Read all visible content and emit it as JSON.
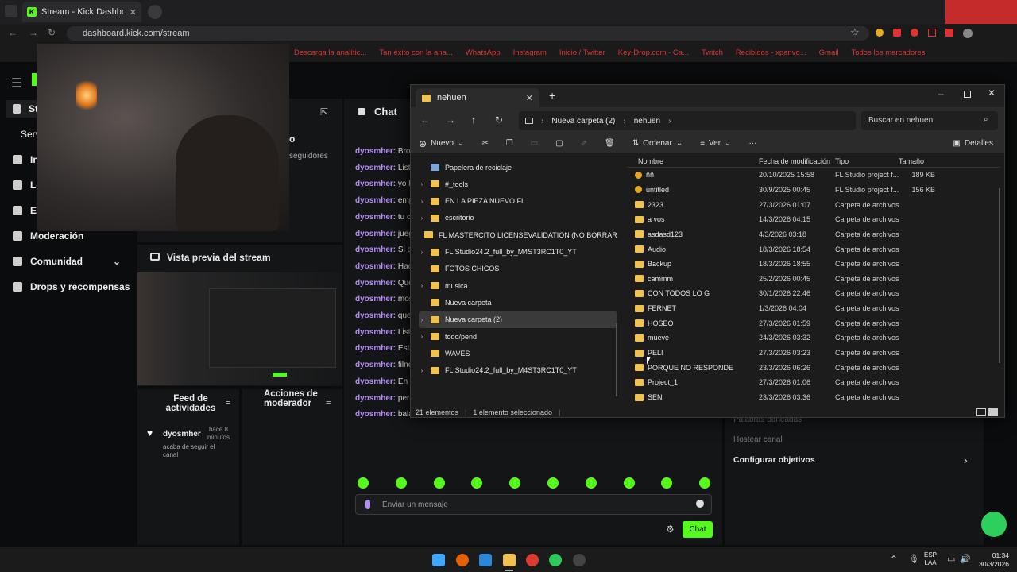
{
  "browser": {
    "tab_title": "Stream - Kick Dashboard",
    "url": "dashboard.kick.com/stream",
    "bookmarks": [
      "Descarga la analític...",
      "Tan éxito con la ana...",
      "WhatsApp",
      "Instagram",
      "Inicio / Twitter",
      "Key-Drop.com - Ca...",
      "Twitch",
      "Recibidos - xpanvo...",
      "Gmail",
      "Todos los marcadores"
    ]
  },
  "kick": {
    "sidebar": [
      {
        "label": "St"
      },
      {
        "label": "Serv"
      },
      {
        "label": "In"
      },
      {
        "label": "Lo"
      },
      {
        "label": "Es"
      },
      {
        "label": "Moderación"
      },
      {
        "label": "Comunidad"
      },
      {
        "label": "Drops y recompensas"
      }
    ],
    "followers_label": "seguidores",
    "name_suffix": "o",
    "preview_title": "Vista previa del stream",
    "chat_title": "Chat",
    "chat_messages": [
      {
        "user": "dyosmher:",
        "text": "Bro,"
      },
      {
        "user": "dyosmher:",
        "text": "Listo"
      },
      {
        "user": "dyosmher:",
        "text": "yo ha"
      },
      {
        "user": "dyosmher:",
        "text": "emp"
      },
      {
        "user": "dyosmher:",
        "text": "tu cu"
      },
      {
        "user": "dyosmher:",
        "text": "jueg"
      },
      {
        "user": "dyosmher:",
        "text": "Si el"
      },
      {
        "user": "dyosmher:",
        "text": "Hace"
      },
      {
        "user": "dyosmher:",
        "text": "Que"
      },
      {
        "user": "dyosmher:",
        "text": "most"
      },
      {
        "user": "dyosmher:",
        "text": "que"
      },
      {
        "user": "dyosmher:",
        "text": "Listo"
      },
      {
        "user": "dyosmher:",
        "text": "Esta"
      },
      {
        "user": "dyosmher:",
        "text": "filno"
      },
      {
        "user": "dyosmher:",
        "text": "En e"
      },
      {
        "user": "dyosmher:",
        "text": "pero"
      },
      {
        "user": "dyosmher:",
        "text": "balac"
      }
    ],
    "activity_feed_title": "Feed de actividades",
    "mod_actions_title": "Acciones de moderador",
    "activity": {
      "user": "dyosmher",
      "time": "hace 8 minutos",
      "action": "acaba de seguir el canal"
    },
    "chat_placeholder": "Enviar un mensaje",
    "chat_button": "Chat",
    "right_panel": {
      "banned_words": "Palabras baneadas",
      "host": "Hostear canal",
      "goals": "Configurar objetivos"
    }
  },
  "explorer": {
    "tab_title": "nehuen",
    "breadcrumb": [
      "Nueva carpeta (2)",
      "nehuen"
    ],
    "search_placeholder": "Buscar en nehuen",
    "toolbar": {
      "new": "Nuevo",
      "sort": "Ordenar",
      "view": "Ver",
      "details": "Detalles"
    },
    "tree": [
      {
        "label": "Papelera de reciclaje",
        "chev": "",
        "sel": false
      },
      {
        "label": "#_tools",
        "chev": "›",
        "sel": false
      },
      {
        "label": "EN LA PIEZA NUEVO FL",
        "chev": "›",
        "sel": false
      },
      {
        "label": "escritorio",
        "chev": "›",
        "sel": false
      },
      {
        "label": "FL MASTERCITO LICENSEVALIDATION (NO BORRAR NI ABRIR)",
        "chev": "",
        "sel": false
      },
      {
        "label": "FL Studio24.2_full_by_M4ST3RC1T0_YT",
        "chev": "›",
        "sel": false
      },
      {
        "label": "FOTOS CHICOS",
        "chev": "",
        "sel": false
      },
      {
        "label": "musica",
        "chev": "›",
        "sel": false
      },
      {
        "label": "Nueva carpeta",
        "chev": "",
        "sel": false
      },
      {
        "label": "Nueva carpeta (2)",
        "chev": "›",
        "sel": true
      },
      {
        "label": "todo/pend",
        "chev": "›",
        "sel": false
      },
      {
        "label": "WAVES",
        "chev": "",
        "sel": false
      },
      {
        "label": "FL Studio24.2_full_by_M4ST3RC1T0_YT",
        "chev": "›",
        "sel": false
      }
    ],
    "columns": [
      "Nombre",
      "Fecha de modificación",
      "Tipo",
      "Tamaño"
    ],
    "files": [
      {
        "name": "ññ",
        "date": "20/10/2025 15:58",
        "type": "FL Studio project f...",
        "size": "189 KB",
        "kind": "flp"
      },
      {
        "name": "untitled",
        "date": "30/9/2025 00:45",
        "type": "FL Studio project f...",
        "size": "156 KB",
        "kind": "flp"
      },
      {
        "name": "2323",
        "date": "27/3/2026 01:07",
        "type": "Carpeta de archivos",
        "size": "",
        "kind": "folder"
      },
      {
        "name": "a vos",
        "date": "14/3/2026 04:15",
        "type": "Carpeta de archivos",
        "size": "",
        "kind": "folder"
      },
      {
        "name": "asdasd123",
        "date": "4/3/2026 03:18",
        "type": "Carpeta de archivos",
        "size": "",
        "kind": "folder"
      },
      {
        "name": "Audio",
        "date": "18/3/2026 18:54",
        "type": "Carpeta de archivos",
        "size": "",
        "kind": "folder"
      },
      {
        "name": "Backup",
        "date": "18/3/2026 18:55",
        "type": "Carpeta de archivos",
        "size": "",
        "kind": "folder"
      },
      {
        "name": "cammm",
        "date": "25/2/2026 00:45",
        "type": "Carpeta de archivos",
        "size": "",
        "kind": "folder"
      },
      {
        "name": "CON TODOS LO G",
        "date": "30/1/2026 22:46",
        "type": "Carpeta de archivos",
        "size": "",
        "kind": "folder"
      },
      {
        "name": "FERNET",
        "date": "1/3/2026 04:04",
        "type": "Carpeta de archivos",
        "size": "",
        "kind": "folder"
      },
      {
        "name": "HOSEO",
        "date": "27/3/2026 01:59",
        "type": "Carpeta de archivos",
        "size": "",
        "kind": "folder"
      },
      {
        "name": "mueve",
        "date": "24/3/2026 03:32",
        "type": "Carpeta de archivos",
        "size": "",
        "kind": "folder"
      },
      {
        "name": "PELI",
        "date": "27/3/2026 03:23",
        "type": "Carpeta de archivos",
        "size": "",
        "kind": "folder"
      },
      {
        "name": "PORQUE NO RESPONDE",
        "date": "23/3/2026 06:26",
        "type": "Carpeta de archivos",
        "size": "",
        "kind": "folder"
      },
      {
        "name": "Project_1",
        "date": "27/3/2026 01:06",
        "type": "Carpeta de archivos",
        "size": "",
        "kind": "folder"
      },
      {
        "name": "SEN",
        "date": "23/3/2026 03:36",
        "type": "Carpeta de archivos",
        "size": "",
        "kind": "folder"
      }
    ],
    "status_count": "21 elementos",
    "status_selected": "1 elemento seleccionado"
  },
  "taskbar": {
    "lang1": "ESP",
    "lang2": "LAA",
    "time": "01:34",
    "date": "30/3/2026"
  },
  "colors": {
    "kick_green": "#53fc18",
    "chat_user": "#b58cf7",
    "folder": "#f1c14f"
  }
}
